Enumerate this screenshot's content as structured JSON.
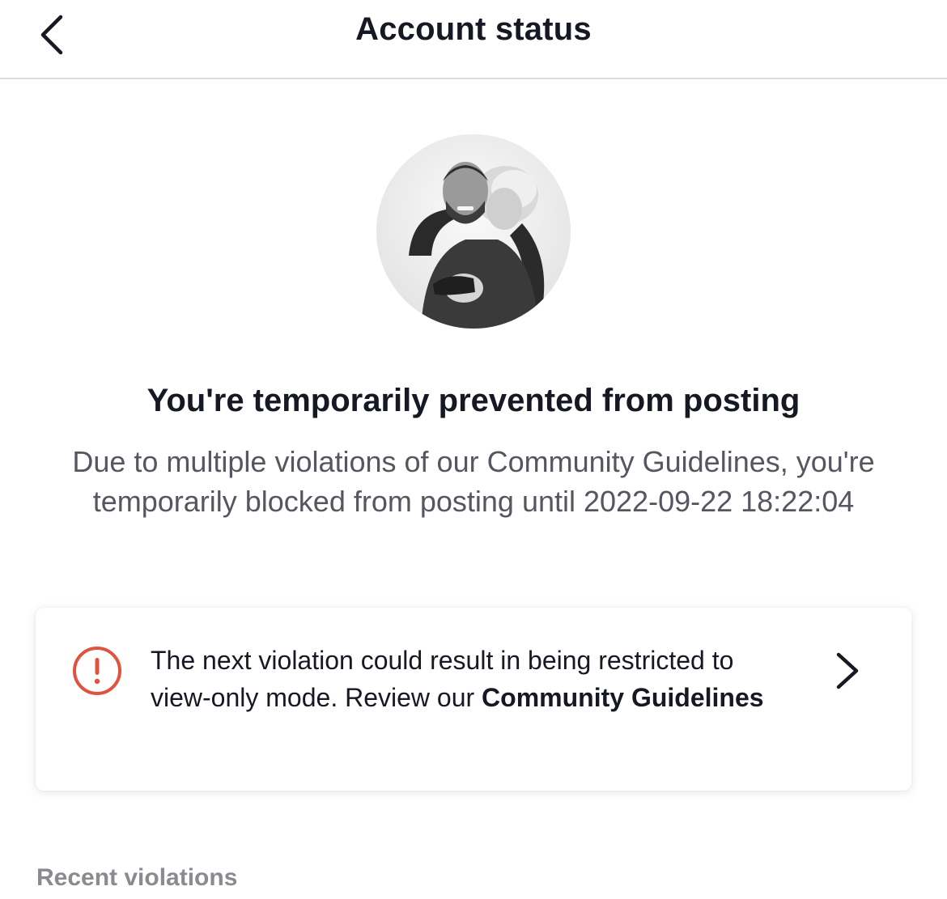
{
  "header": {
    "title": "Account status",
    "back_icon": "chevron-left-icon"
  },
  "profile": {
    "avatar": "profile-photo"
  },
  "status": {
    "headline": "You're temporarily prevented from posting",
    "description": "Due to multiple violations of our Community Guidelines, you're temporarily blocked from posting until 2022-09-22 18:22:04"
  },
  "warning_card": {
    "icon": "alert-circle-icon",
    "icon_color": "#e0533f",
    "text": "The next violation could result in being restricted to view-only mode. Review our ",
    "link_text": "Community Guidelines",
    "chevron_icon": "chevron-right-icon"
  },
  "sections": {
    "recent_violations": "Recent violations"
  }
}
